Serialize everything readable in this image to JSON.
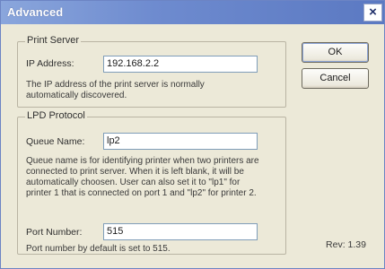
{
  "window": {
    "title": "Advanced",
    "close_glyph": "×"
  },
  "print_server": {
    "group_label": "Print Server",
    "ip_label": "IP Address:",
    "ip_value": "192.168.2.2",
    "description": "The IP address of the print server is normally automatically discovered."
  },
  "lpd_protocol": {
    "group_label": "LPD Protocol",
    "queue_label": "Queue Name:",
    "queue_value": "lp2",
    "queue_description": "Queue name is for identifying printer when two printers are connected to print server. When it is left blank, it will be automatically choosen. User can also set it to \"lp1\" for printer 1 that is connected on port 1 and \"lp2\" for printer 2.",
    "port_label": "Port Number:",
    "port_value": "515",
    "port_description": "Port number by default is set to 515."
  },
  "buttons": {
    "ok_label": "OK",
    "cancel_label": "Cancel"
  },
  "revision": "Rev: 1.39"
}
